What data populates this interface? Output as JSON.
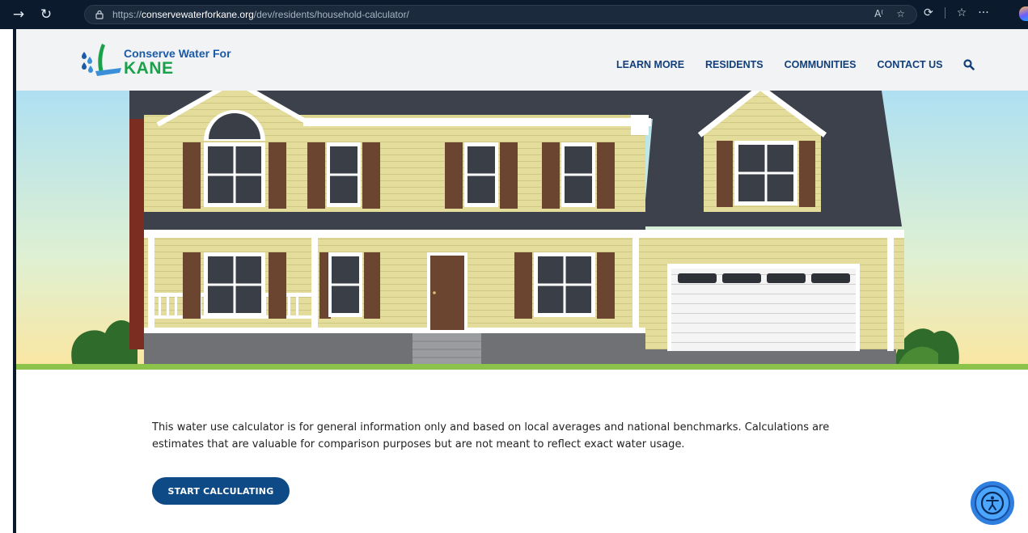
{
  "browser": {
    "url_scheme": "https://",
    "url_host": "conservewaterforkane.org",
    "url_path": "/dev/residents/household-calculator/",
    "reader_icon": "read-aloud-icon",
    "favorite_icon": "star-icon"
  },
  "logo": {
    "line1": "Conserve Water For",
    "line2": "KANE",
    "colors": {
      "blue": "#1a5aa8",
      "green": "#1aa14a"
    }
  },
  "nav": {
    "items": [
      {
        "label": "LEARN MORE"
      },
      {
        "label": "RESIDENTS"
      },
      {
        "label": "COMMUNITIES"
      },
      {
        "label": "CONTACT US"
      }
    ],
    "search_icon": "search-icon"
  },
  "content": {
    "intro_line1": "This water use calculator is for general information only and based on local averages and national benchmarks. Calculations are",
    "intro_line2": "estimates that are valuable for comparison purposes but are not meant to reflect exact water usage.",
    "start_button": "START CALCULATING"
  },
  "accessibility": {
    "icon": "accessibility-icon"
  },
  "colors": {
    "nav_text": "#123f7a",
    "button": "#0d4a86",
    "siding": "#e3dc9a",
    "roof": "#3c414b",
    "shutter": "#6b4530",
    "ground": "#8cc34a"
  }
}
